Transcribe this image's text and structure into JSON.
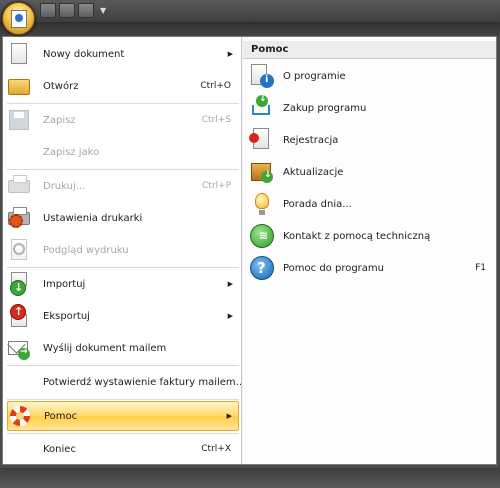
{
  "menu": {
    "items": [
      {
        "label": "Nowy dokument",
        "shortcut": "",
        "icon": "new-document-icon"
      },
      {
        "label": "Otwórz",
        "shortcut": "Ctrl+O",
        "icon": "open-folder-icon"
      },
      {
        "label": "Zapisz",
        "shortcut": "Ctrl+S",
        "icon": "save-icon"
      },
      {
        "label": "Zapisz jako",
        "shortcut": "",
        "icon": ""
      },
      {
        "label": "Drukuj...",
        "shortcut": "Ctrl+P",
        "icon": "printer-icon"
      },
      {
        "label": "Ustawienia drukarki",
        "shortcut": "",
        "icon": "printer-settings-icon"
      },
      {
        "label": "Podgląd wydruku",
        "shortcut": "",
        "icon": "print-preview-icon"
      },
      {
        "label": "Importuj",
        "shortcut": "",
        "icon": "import-icon"
      },
      {
        "label": "Eksportuj",
        "shortcut": "",
        "icon": "export-icon"
      },
      {
        "label": "Wyślij dokument mailem",
        "shortcut": "",
        "icon": "mail-icon"
      },
      {
        "label": "Potwierdź wystawienie faktury mailem...",
        "shortcut": "",
        "icon": ""
      },
      {
        "label": "Pomoc",
        "shortcut": "",
        "icon": "help-lifebuoy-icon"
      },
      {
        "label": "Koniec",
        "shortcut": "Ctrl+X",
        "icon": ""
      }
    ]
  },
  "help": {
    "title": "Pomoc",
    "items": [
      {
        "label": "O programie",
        "shortcut": "",
        "icon": "about-icon"
      },
      {
        "label": "Zakup programu",
        "shortcut": "",
        "icon": "cart-icon"
      },
      {
        "label": "Rejestracja",
        "shortcut": "",
        "icon": "registration-icon"
      },
      {
        "label": "Aktualizacje",
        "shortcut": "",
        "icon": "updates-icon"
      },
      {
        "label": "Porada dnia...",
        "shortcut": "",
        "icon": "tip-bulb-icon"
      },
      {
        "label": "Kontakt z pomocą techniczną",
        "shortcut": "",
        "icon": "support-icon"
      },
      {
        "label": "Pomoc do programu",
        "shortcut": "F1",
        "icon": "help-question-icon"
      }
    ]
  },
  "colors": {
    "highlight": "#ffd96b",
    "disabled_text": "#a7a7a7",
    "accent_blue": "#1f74c4"
  }
}
